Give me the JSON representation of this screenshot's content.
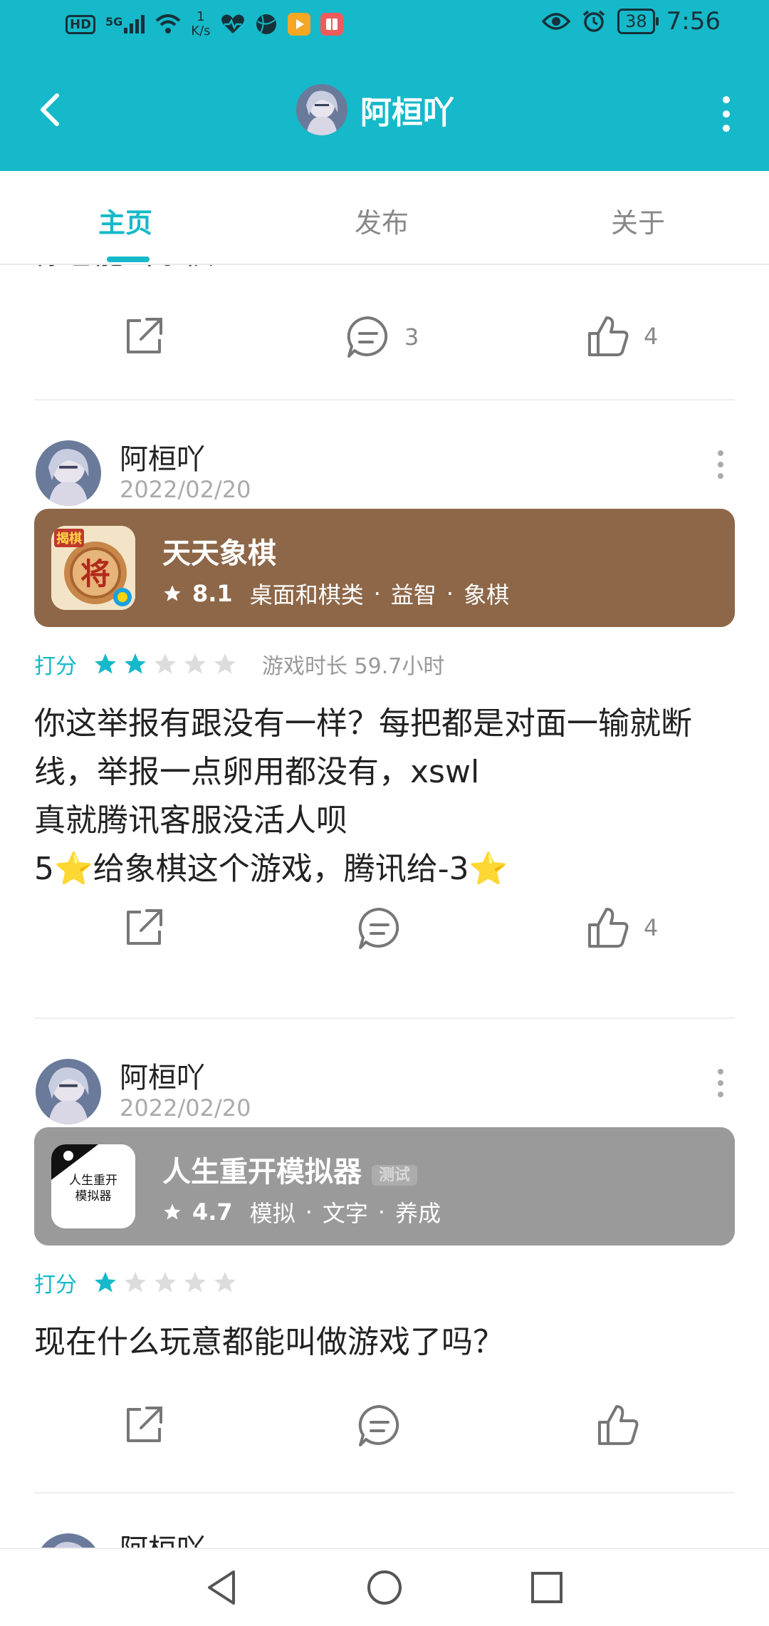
{
  "status_bar": {
    "network_badge": "HD",
    "signal": "5G",
    "speed_value": "1",
    "speed_unit": "K/s",
    "battery": "38",
    "time": "7:56"
  },
  "app_bar": {
    "title": "阿桓吖"
  },
  "tabs": [
    {
      "label": "主页"
    },
    {
      "label": "发布"
    },
    {
      "label": "关于"
    }
  ],
  "top_partial": {
    "text": "你也能叫象棋？",
    "comment_count": "3",
    "like_count": "4"
  },
  "posts": [
    {
      "author": "阿桓吖",
      "date": "2022/02/20",
      "game": {
        "name": "天天象棋",
        "score": "8.1",
        "tags": [
          "桌面和棋类",
          "益智",
          "象棋"
        ],
        "card_color": "#8d6748"
      },
      "rating_label": "打分",
      "rating": 2,
      "playtime": "游戏时长 59.7小时",
      "body": "你这举报有跟没有一样？每把都是对面一输就断线，举报一点卵用都没有，xswl\n真就腾讯客服没活人呗\n5⭐给象棋这个游戏，腾讯给-3⭐",
      "comment_count": "",
      "like_count": "4"
    },
    {
      "author": "阿桓吖",
      "date": "2022/02/20",
      "game": {
        "name": "人生重开模拟器",
        "beta_tag": "测试",
        "icon_text_1": "人生重开",
        "icon_text_2": "模拟器",
        "score": "4.7",
        "tags": [
          "模拟",
          "文字",
          "养成"
        ],
        "card_color": "#9a9a9a"
      },
      "rating_label": "打分",
      "rating": 1,
      "body": "现在什么玩意都能叫做游戏了吗？",
      "comment_count": "",
      "like_count": ""
    },
    {
      "author": "阿桓吖"
    }
  ],
  "colors": {
    "accent": "#16b9c9",
    "star_inactive": "#dcdcdc"
  }
}
